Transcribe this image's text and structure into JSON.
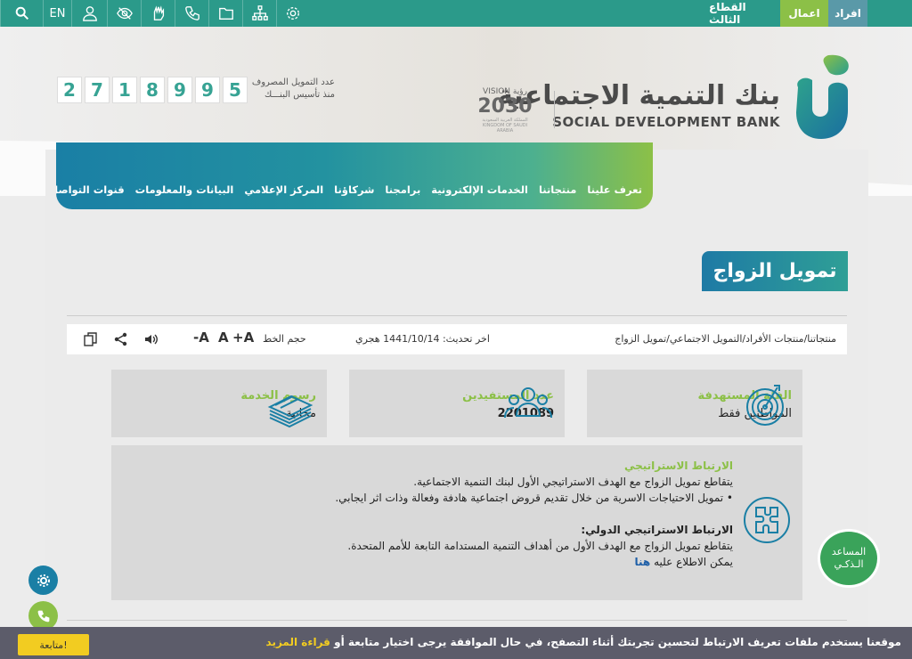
{
  "topbar": {
    "segments": {
      "individuals": "افراد",
      "business": "اعمال",
      "third_sector": "القطاع الثالث"
    },
    "lang": "EN",
    "tools": [
      "search-icon",
      "user-icon",
      "eye-slash-icon",
      "sign-language-icon",
      "phone-icon",
      "folder-icon",
      "sitemap-icon",
      "settings-icon"
    ]
  },
  "header": {
    "logo_ar": "بنك التنمية الاجتماعية",
    "logo_en": "SOCIAL DEVELOPMENT BANK",
    "vision_top": "VISION رؤية",
    "vision_year": "2030",
    "vision_bottom": "المملكة العربية السعودية KINGDOM OF SAUDI ARABIA",
    "counter_label_1": "عدد التمويل المصروف",
    "counter_label_2": "منذ تأسيس البنـــك",
    "counter_digits": [
      "2",
      "7",
      "1",
      "8",
      "9",
      "9",
      "5"
    ]
  },
  "nav": {
    "items": [
      "تعرف علينا",
      "منتجاتنا",
      "الخدمات الإلكترونية",
      "برامجنا",
      "شركاؤنا",
      "المركز الإعلامي",
      "البيانات والمعلومات",
      "قنوات التواصل"
    ]
  },
  "page": {
    "title": "تمويل الزواج",
    "breadcrumb": "منتجاتنا/منتجات الأفراد/التمويل الاجتماعي/تمويل الزواج",
    "updated": "اخر تحديث: 1441/10/14 هجري",
    "font_size_label": "حجم الخط",
    "font_sizes": {
      "increase": "+A",
      "normal": "A",
      "decrease": "-A"
    }
  },
  "cards": [
    {
      "label": "الفئة المستهدفة",
      "value": "المواطنين فقط",
      "icon": "target-icon"
    },
    {
      "label": "عدد المستفيدين",
      "value": "2201089",
      "icon": "people-icon"
    },
    {
      "label": "رسوم الخدمة",
      "value": "مجانية",
      "icon": "money-stack-icon"
    }
  ],
  "strategy": {
    "head1": "الارتباط الاستراتيجي",
    "line1": "يتقاطع تمويل الزواج مع الهدف الاستراتيجي الأول لبنك التنمية الاجتماعية.",
    "line2": "• تمويل الاحتياجات الاسرية من خلال تقديم قروض اجتماعية هادفة وفعالة وذات اثر ايجابي.",
    "head2": "الارتباط الاستراتيجي الدولي:",
    "line3": "يتقاطع تمويل الزواج مع الهدف الأول من أهداف التنمية المستدامة التابعة للأمم المتحدة.",
    "line4_prefix": "يمكن الاطلاع عليه",
    "line4_link": "هنا"
  },
  "assistant": {
    "line1": "المساعد",
    "line2": "الـذكـي"
  },
  "cookie": {
    "text": "موقعنا يستخدم ملفات تعريف الارتباط لتحسين تجربتك أثناء التصفح، في حال الموافقة يرجى اختيار متابعة أو",
    "more": "قراءة المزيد",
    "button": "متابعة!"
  },
  "colors": {
    "teal": "#2b9a8a",
    "green": "#8cc047",
    "blue": "#1a7fa5",
    "yellow": "#f2cc21"
  }
}
